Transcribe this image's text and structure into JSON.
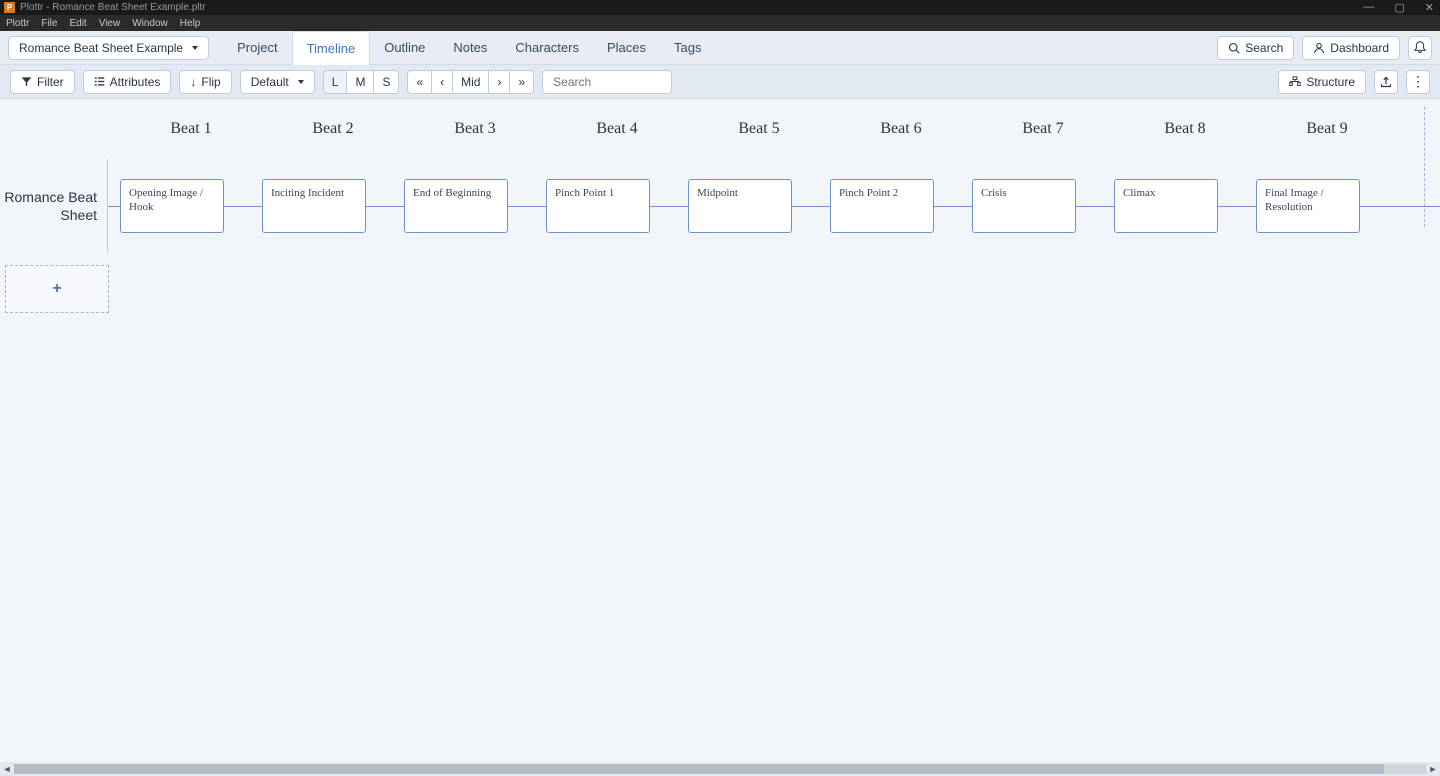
{
  "window": {
    "app_name": "Plottr",
    "title": "Plottr - Romance Beat Sheet Example.pltr",
    "icon_letter": "P"
  },
  "menu": {
    "items": [
      "Plottr",
      "File",
      "Edit",
      "View",
      "Window",
      "Help"
    ]
  },
  "nav": {
    "project_selector": "Romance Beat Sheet Example",
    "tabs": [
      {
        "label": "Project",
        "active": false
      },
      {
        "label": "Timeline",
        "active": true
      },
      {
        "label": "Outline",
        "active": false
      },
      {
        "label": "Notes",
        "active": false
      },
      {
        "label": "Characters",
        "active": false
      },
      {
        "label": "Places",
        "active": false
      },
      {
        "label": "Tags",
        "active": false
      }
    ],
    "search_button": "Search",
    "dashboard_button": "Dashboard"
  },
  "toolbar": {
    "filter_label": "Filter",
    "attributes_label": "Attributes",
    "flip_label": "Flip",
    "zoom_preset_label": "Default",
    "zoom_sizes": [
      "L",
      "M",
      "S"
    ],
    "zoom_active": "L",
    "nav_mid_label": "Mid",
    "search_placeholder": "Search",
    "structure_label": "Structure"
  },
  "timeline": {
    "plotlines": [
      {
        "name": "Romance Beat Sheet"
      }
    ],
    "beats": [
      {
        "header": "Beat 1",
        "card": "Opening Image / Hook"
      },
      {
        "header": "Beat 2",
        "card": "Inciting Incident"
      },
      {
        "header": "Beat 3",
        "card": "End of Beginning"
      },
      {
        "header": "Beat 4",
        "card": "Pinch Point 1"
      },
      {
        "header": "Beat 5",
        "card": "Midpoint"
      },
      {
        "header": "Beat 6",
        "card": "Pinch Point 2"
      },
      {
        "header": "Beat 7",
        "card": "Crisis"
      },
      {
        "header": "Beat 8",
        "card": "Climax"
      },
      {
        "header": "Beat 9",
        "card": "Final Image / Resolution"
      }
    ],
    "add_plotline_label": "+"
  },
  "scrollbar": {
    "thumb_width_percent": 97
  }
}
